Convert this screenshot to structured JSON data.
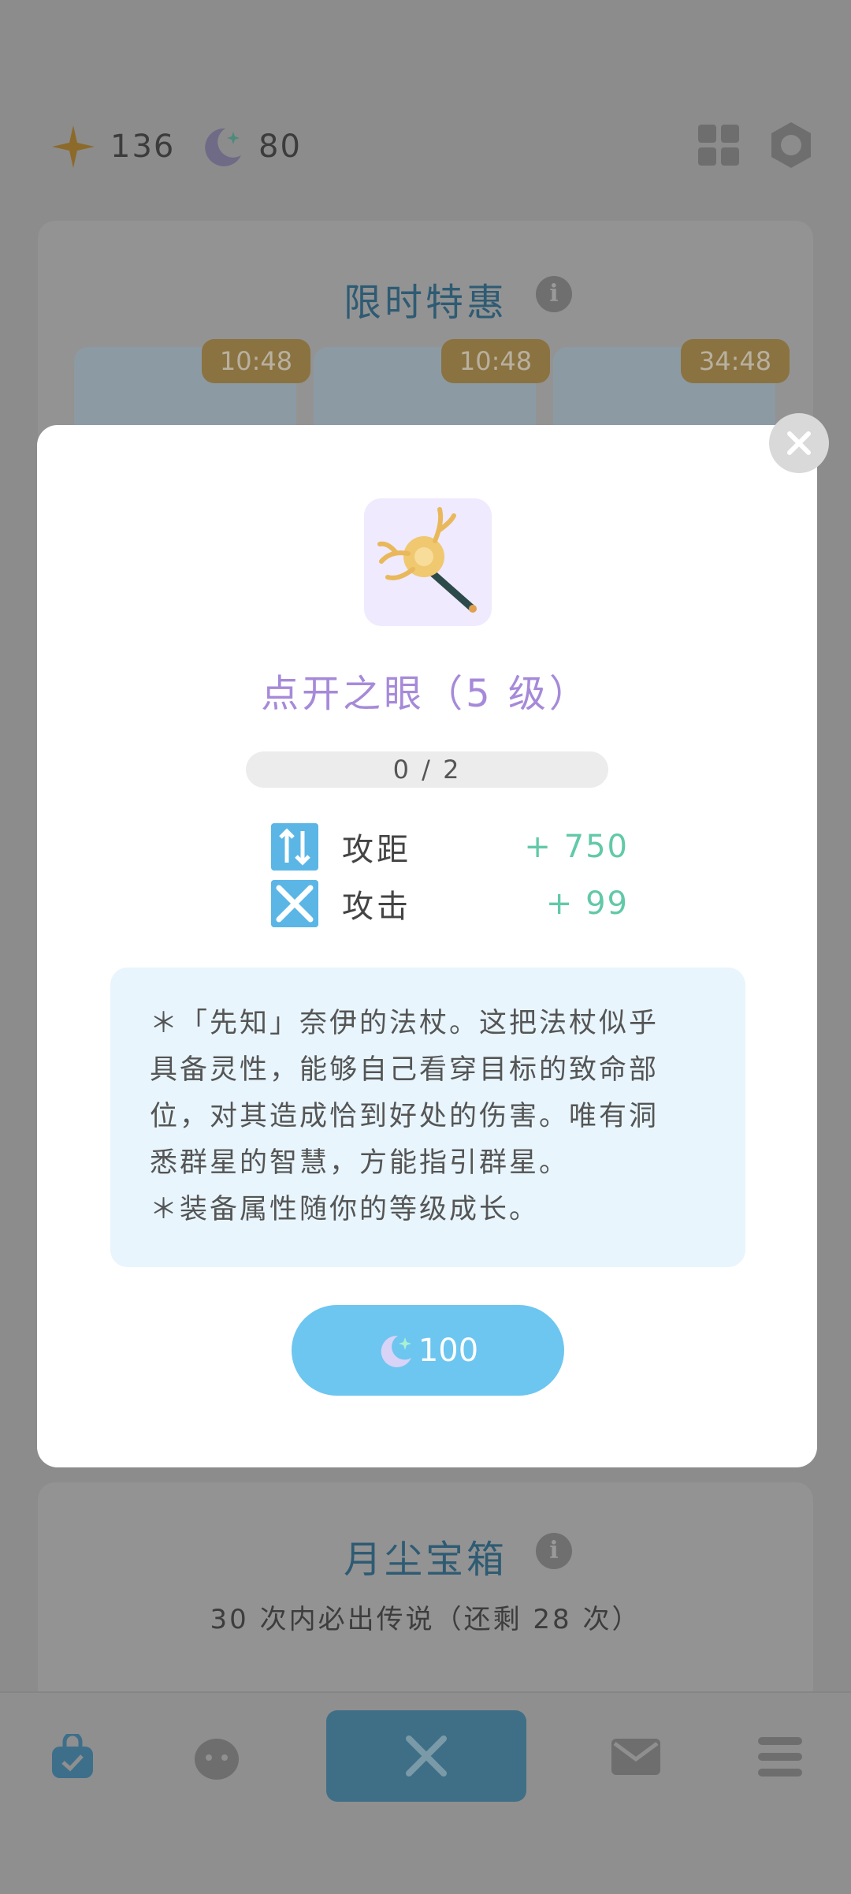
{
  "currency": {
    "stars": "136",
    "moondust": "80"
  },
  "limited_offer": {
    "title": "限时特惠",
    "timers": [
      "10:48",
      "10:48",
      "34:48"
    ]
  },
  "modal": {
    "item_name": "点开之眼（5 级）",
    "progress": "0 / 2",
    "progress_fraction": 0,
    "stats": [
      {
        "label": "攻距",
        "value": "+ 750",
        "icon": "range-arrows-icon"
      },
      {
        "label": "攻击",
        "value": "+ 99",
        "icon": "crossed-swords-icon"
      }
    ],
    "description_lines": [
      "＊「先知」奈伊的法杖。这把法杖似乎",
      "具备灵性，能够自己看穿目标的致命部",
      "位，对其造成恰到好处的伤害。唯有洞",
      "悉群星的智慧，方能指引群星。",
      "＊装备属性随你的等级成长。"
    ],
    "price": "100"
  },
  "moondust_chest": {
    "title": "月尘宝箱",
    "subtitle": "30 次内必出传说（还剩 28 次）"
  },
  "colors": {
    "accent_blue": "#6cc6f0",
    "title_purple": "#a68ad9",
    "stat_green": "#62c9a8",
    "desc_bg": "#e8f5fd"
  }
}
